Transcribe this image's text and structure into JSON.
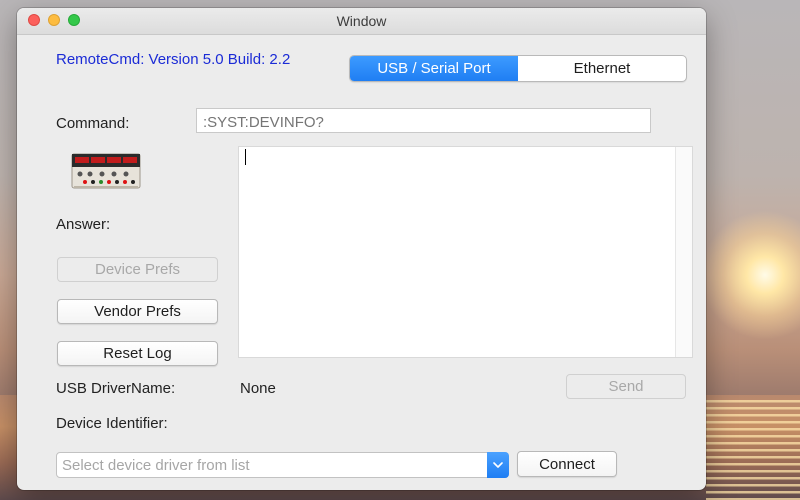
{
  "window": {
    "title": "Window"
  },
  "header": {
    "version": "RemoteCmd: Version 5.0 Build: 2.2"
  },
  "connection_tabs": {
    "items": [
      {
        "label": "USB / Serial Port",
        "selected": true
      },
      {
        "label": "Ethernet",
        "selected": false
      }
    ]
  },
  "command": {
    "label": "Command:",
    "placeholder": ":SYST:DEVINFO?",
    "value": ""
  },
  "answer": {
    "label": "Answer:",
    "text": ""
  },
  "buttons": {
    "device_prefs": "Device Prefs",
    "vendor_prefs": "Vendor Prefs",
    "reset_log": "Reset Log",
    "send": "Send",
    "connect": "Connect"
  },
  "usb_driver": {
    "label": "USB DriverName:",
    "value": "None"
  },
  "device_identifier": {
    "label": "Device Identifier:",
    "value": ""
  },
  "driver_select": {
    "placeholder": "Select device driver from list"
  },
  "colors": {
    "accent": "#1f7ef3",
    "version_text": "#1b2bd6"
  }
}
